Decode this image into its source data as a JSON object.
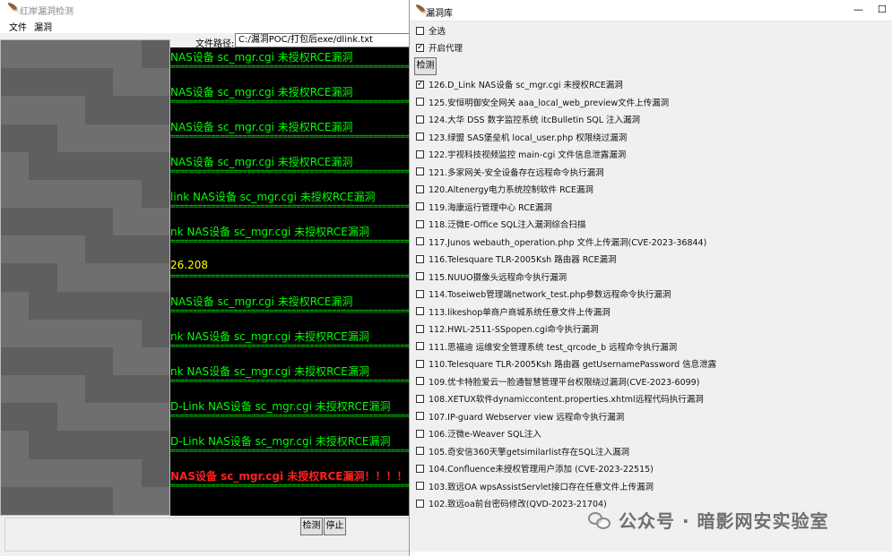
{
  "back_window": {
    "title": "红岸漏洞检测",
    "menu": [
      "文件",
      "漏洞"
    ],
    "path_label": "文件路径:",
    "path_value": "C:/漏洞POC/打包后exe/dlink.txt",
    "buttons": {
      "detect": "检测",
      "stop": "停止"
    },
    "console": {
      "separator": "================================================================",
      "lines": [
        "NAS设备 sc_mgr.cgi 未授权RCE漏洞",
        "NAS设备 sc_mgr.cgi 未授权RCE漏洞",
        "NAS设备 sc_mgr.cgi 未授权RCE漏洞",
        "NAS设备 sc_mgr.cgi 未授权RCE漏洞",
        "link NAS设备 sc_mgr.cgi 未授权RCE漏洞",
        "nk NAS设备 sc_mgr.cgi 未授权RCE漏洞",
        "26.208",
        "NAS设备 sc_mgr.cgi 未授权RCE漏洞",
        "nk NAS设备 sc_mgr.cgi 未授权RCE漏洞",
        "nk NAS设备 sc_mgr.cgi 未授权RCE漏洞",
        "D-Link NAS设备 sc_mgr.cgi 未授权RCE漏洞",
        "D-Link NAS设备 sc_mgr.cgi 未授权RCE漏洞",
        "NAS设备 sc_mgr.cgi 未授权RCE漏洞！！！！"
      ]
    }
  },
  "vuln_window": {
    "title": "漏洞库",
    "select_all": "全选",
    "proxy": "开启代理",
    "detect_button": "检测",
    "items": [
      {
        "label": "126.D_Link NAS设备 sc_mgr.cgi 未授权RCE漏洞",
        "checked": true
      },
      {
        "label": "125.安恒明御安全网关 aaa_local_web_preview文件上传漏洞",
        "checked": false
      },
      {
        "label": "124.大华 DSS 数字监控系统 itcBulletin SQL 注入漏洞",
        "checked": false
      },
      {
        "label": "123.绿盟 SAS堡垒机 local_user.php 权限绕过漏洞",
        "checked": false
      },
      {
        "label": "122.宇视科技视频监控 main-cgi 文件信息泄露漏洞",
        "checked": false
      },
      {
        "label": "121.多家网关-安全设备存在远程命令执行漏洞",
        "checked": false
      },
      {
        "label": "120.Altenergy电力系统控制软件 RCE漏洞",
        "checked": false
      },
      {
        "label": "119.海康运行管理中心 RCE漏洞",
        "checked": false
      },
      {
        "label": "118.泛微E-Office SQL注入漏洞综合扫描",
        "checked": false
      },
      {
        "label": "117.Junos webauth_operation.php 文件上传漏洞(CVE-2023-36844)",
        "checked": false
      },
      {
        "label": "116.Telesquare TLR-2005Ksh 路由器 RCE漏洞",
        "checked": false
      },
      {
        "label": "115.NUUO摄像头远程命令执行漏洞",
        "checked": false
      },
      {
        "label": "114.Toseiweb管理端network_test.php参数远程命令执行漏洞",
        "checked": false
      },
      {
        "label": "113.likeshop单商户商城系统任意文件上传漏洞",
        "checked": false
      },
      {
        "label": "112.HWL-2511-SSpopen.cgi命令执行漏洞",
        "checked": false
      },
      {
        "label": "111.思福迪 运维安全管理系统 test_qrcode_b 远程命令执行漏洞",
        "checked": false
      },
      {
        "label": "110.Telesquare TLR-2005Ksh 路由器 getUsernamePassword 信息泄露",
        "checked": false
      },
      {
        "label": "109.优卡特脸爱云一脸通智慧管理平台权限绕过漏洞(CVE-2023-6099)",
        "checked": false
      },
      {
        "label": "108.XETUX软件dynamiccontent.properties.xhtml远程代码执行漏洞",
        "checked": false
      },
      {
        "label": "107.IP-guard Webserver view 远程命令执行漏洞",
        "checked": false
      },
      {
        "label": "106.泛微e-Weaver SQL注入",
        "checked": false
      },
      {
        "label": "105.奇安信360天擎getsimilarlist存在SQL注入漏洞",
        "checked": false
      },
      {
        "label": "104.Confluence未授权管理用户添加 (CVE-2023-22515)",
        "checked": false
      },
      {
        "label": "103.致远OA wpsAssistServlet接口存在任意文件上传漏洞",
        "checked": false
      },
      {
        "label": "102.致远oa前台密码修改(QVD-2023-21704)",
        "checked": false
      }
    ]
  },
  "watermark": "公众号 · 暗影网安实验室"
}
